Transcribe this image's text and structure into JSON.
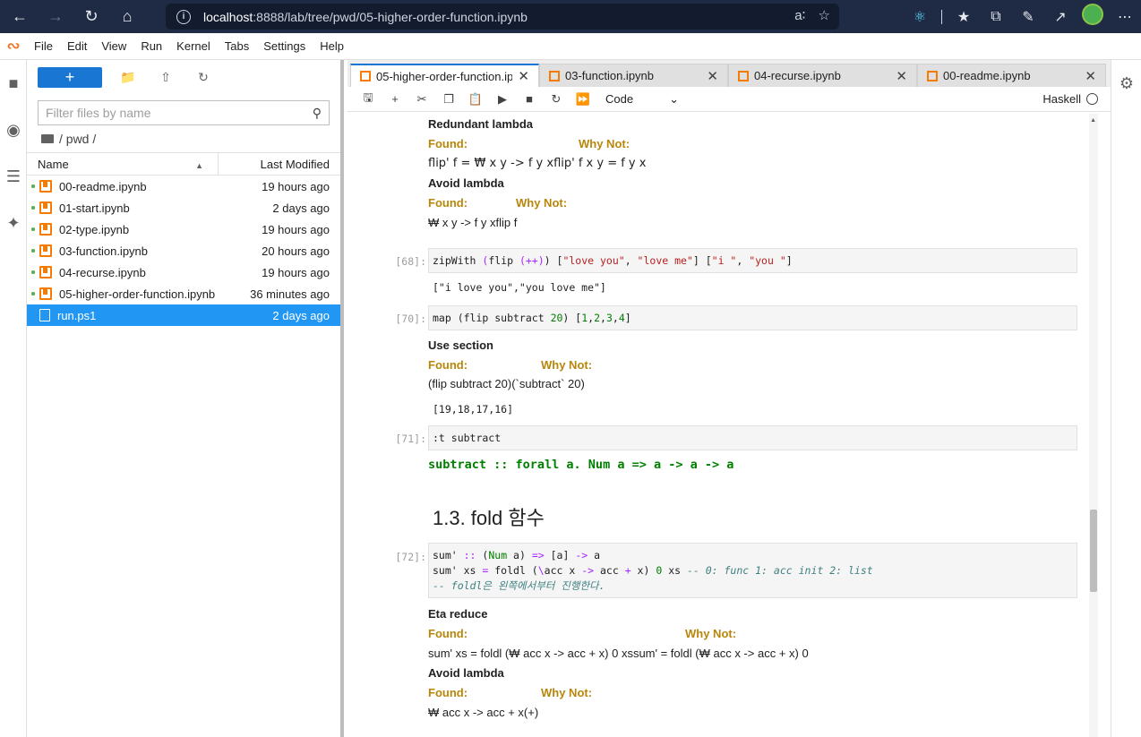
{
  "browser": {
    "url_host": "localhost",
    "url_rest": ":8888/lab/tree/pwd/05-higher-order-function.ipynb"
  },
  "menu": [
    "File",
    "Edit",
    "View",
    "Run",
    "Kernel",
    "Tabs",
    "Settings",
    "Help"
  ],
  "filebrowser": {
    "new_label": "+",
    "filter_placeholder": "Filter files by name",
    "breadcrumb": "/ pwd /",
    "col_name": "Name",
    "col_modified": "Last Modified",
    "files": [
      {
        "name": "00-readme.ipynb",
        "modified": "19 hours ago"
      },
      {
        "name": "01-start.ipynb",
        "modified": "2 days ago"
      },
      {
        "name": "02-type.ipynb",
        "modified": "19 hours ago"
      },
      {
        "name": "03-function.ipynb",
        "modified": "20 hours ago"
      },
      {
        "name": "04-recurse.ipynb",
        "modified": "19 hours ago"
      },
      {
        "name": "05-higher-order-function.ipynb",
        "modified": "36 minutes ago"
      },
      {
        "name": "run.ps1",
        "modified": "2 days ago"
      }
    ]
  },
  "tabs": [
    {
      "label": "05-higher-order-function.ipynb"
    },
    {
      "label": "03-function.ipynb"
    },
    {
      "label": "04-recurse.ipynb"
    },
    {
      "label": "00-readme.ipynb"
    }
  ],
  "toolbar": {
    "cell_type": "Code",
    "kernel": "Haskell"
  },
  "notebook": {
    "hint1_title": "Redundant lambda",
    "found": "Found:",
    "why_not": "Why Not:",
    "hint1_code": "flip' f = ₩ x y -> f y xflip' f x y = f y x",
    "hint2_title": "Avoid lambda",
    "hint2_code": "₩ x y -> f y xflip f",
    "cell68_prompt": "[68]:",
    "cell68_out": "[\"i love you\",\"you love me\"]",
    "cell70_prompt": "[70]:",
    "hint3_title": "Use section",
    "hint3_code": "(flip subtract 20)(`subtract` 20)",
    "cell70_out": "[19,18,17,16]",
    "cell71_prompt": "[71]:",
    "cell71_code": ":t subtract",
    "cell71_out": "subtract :: forall a. Num a => a -> a -> a",
    "heading": "1.3. fold 함수",
    "cell72_prompt": "[72]:",
    "hint4_title": "Eta reduce",
    "hint4_code": "sum' xs = foldl (₩ acc x -> acc + x) 0 xssum' = foldl (₩ acc x -> acc + x) 0",
    "hint5_title": "Avoid lambda",
    "hint5_code": "₩ acc x -> acc + x(+)"
  }
}
